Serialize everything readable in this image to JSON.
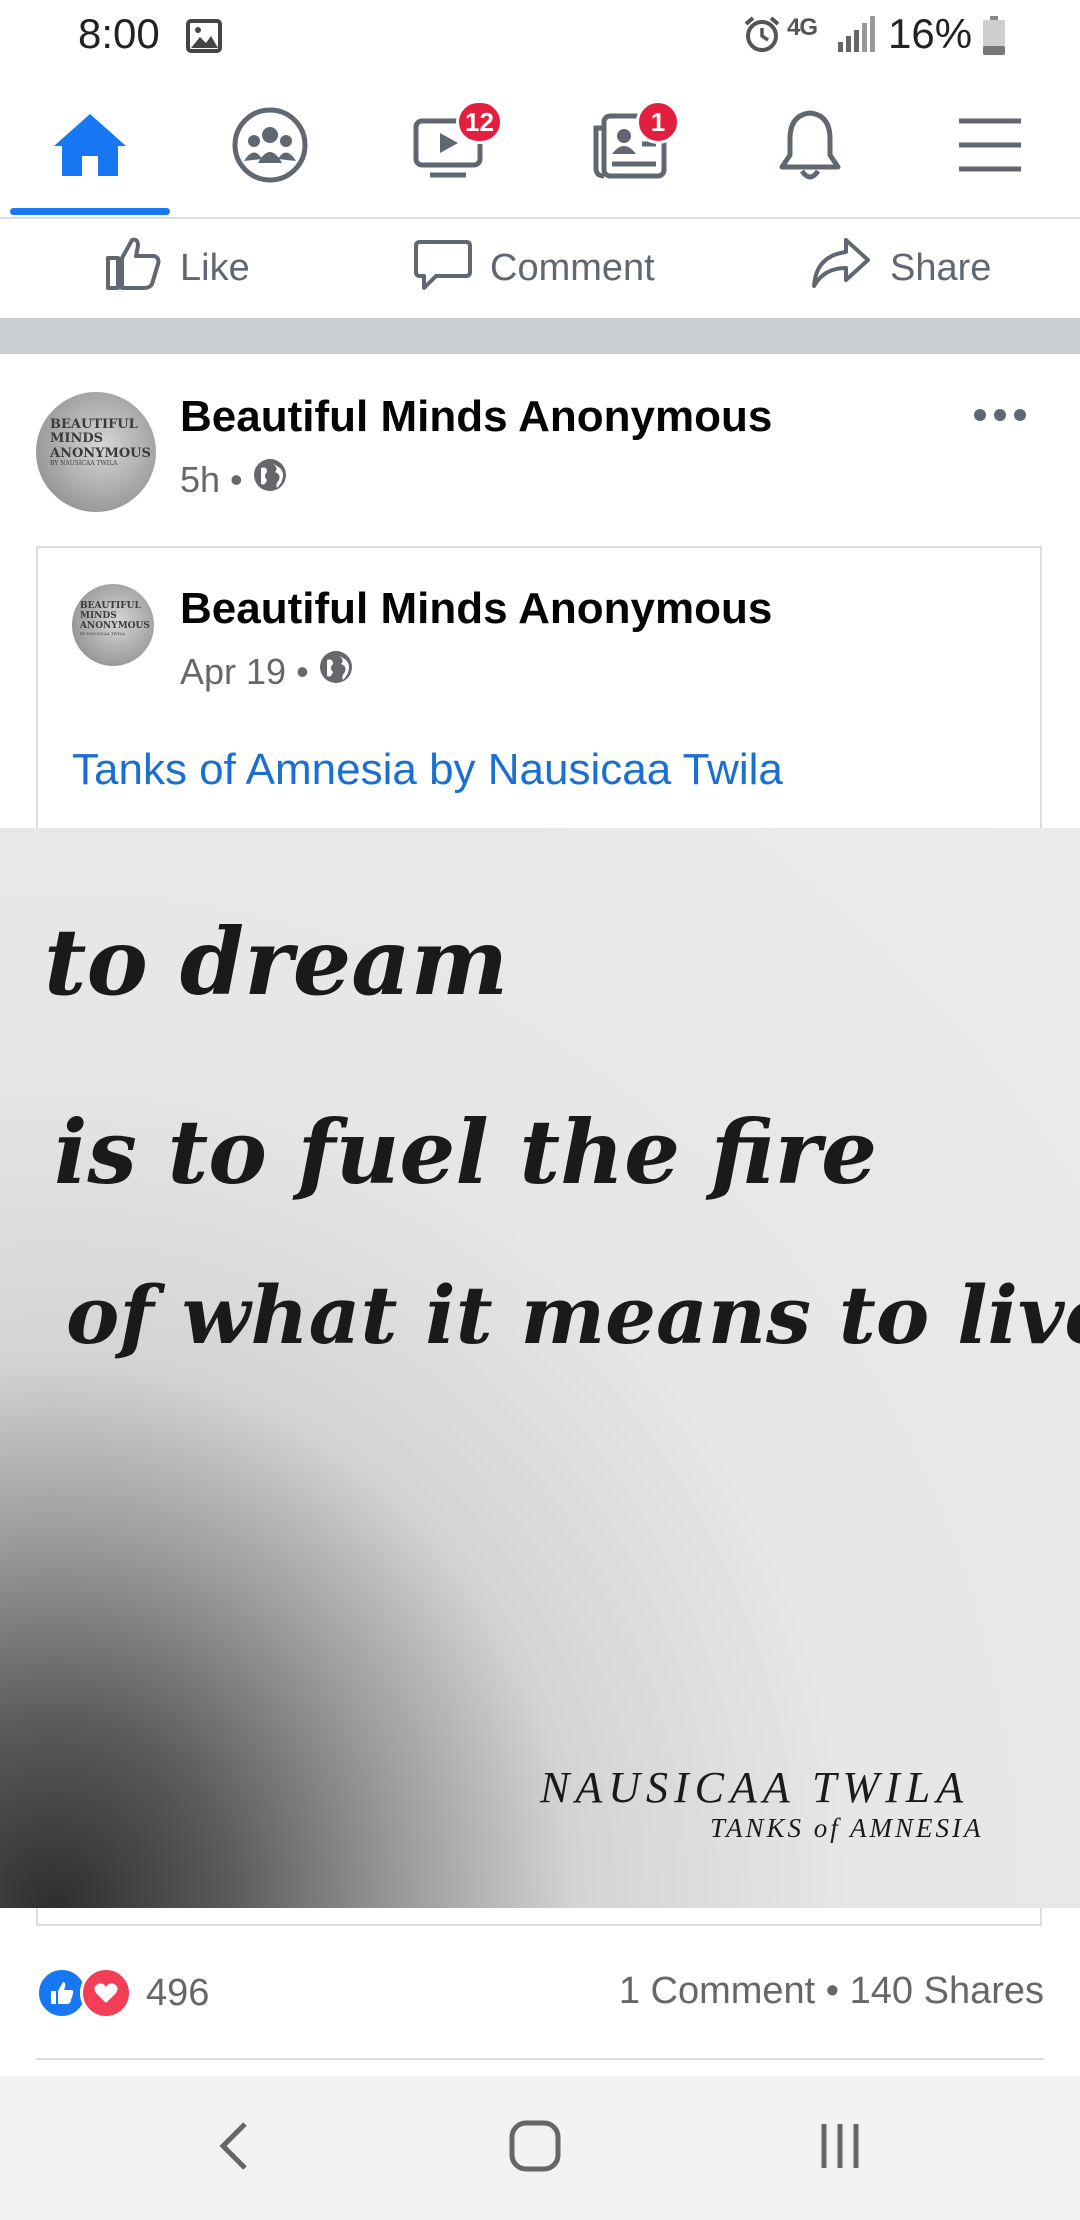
{
  "status_bar": {
    "time": "8:00",
    "network": "4G",
    "battery": "16%",
    "icons": [
      "gallery-icon",
      "alarm-icon",
      "signal-icon",
      "battery-icon"
    ]
  },
  "nav": {
    "accent": "#1877f2",
    "tabs": [
      {
        "name": "home",
        "icon": "home-icon",
        "active": true
      },
      {
        "name": "groups",
        "icon": "groups-icon"
      },
      {
        "name": "watch",
        "icon": "watch-icon",
        "badge": "12"
      },
      {
        "name": "news",
        "icon": "news-icon",
        "badge": "1"
      },
      {
        "name": "notifications",
        "icon": "bell-icon"
      },
      {
        "name": "menu",
        "icon": "hamburger-icon"
      }
    ]
  },
  "actions": {
    "like": "Like",
    "comment": "Comment",
    "share": "Share"
  },
  "post": {
    "author": "Beautiful Minds Anonymous",
    "time": "5h",
    "dot": "•",
    "privacy_icon": "globe-icon",
    "avatar_text": [
      "BEAUTIFUL",
      "MINDS",
      "ANONYMOUS",
      "BY NAUSICAA TWILA"
    ],
    "shared": {
      "author": "Beautiful Minds Anonymous",
      "date": "Apr 19",
      "dot": "•",
      "privacy_icon": "globe-icon",
      "link_text": "Tanks of Amnesia by Nausicaa Twila",
      "image": {
        "quote_lines": [
          "to dream",
          "is to fuel the fire",
          "of what it means to live."
        ],
        "author": "NAUSICAA TWILA",
        "book": "TANKS of AMNESIA"
      }
    },
    "reactions": {
      "icons": [
        "like-reaction-icon",
        "love-reaction-icon"
      ],
      "count": "496"
    },
    "stats": "1 Comment • 140 Shares"
  },
  "system_nav": {
    "back": "back-icon",
    "home": "home-button-icon",
    "recents": "recents-icon"
  }
}
